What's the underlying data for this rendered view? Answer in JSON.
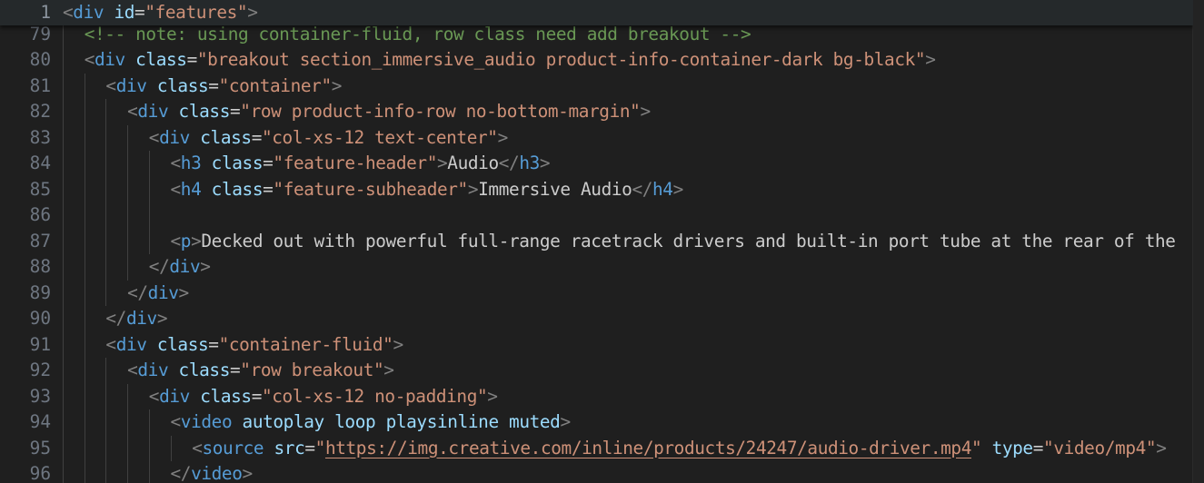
{
  "editor": {
    "sticky_line": {
      "number": "1",
      "tokens": [
        [
          "punct",
          "<"
        ],
        [
          "tag",
          "div"
        ],
        [
          "text",
          " "
        ],
        [
          "attr",
          "id"
        ],
        [
          "eq",
          "="
        ],
        [
          "str",
          "\"features\""
        ],
        [
          "punct",
          ">"
        ]
      ]
    },
    "lines": [
      {
        "number": "79",
        "indent": 1,
        "tokens": [
          [
            "comment",
            "<!-- note: using container-fluid, row class need add breakout -->"
          ]
        ]
      },
      {
        "number": "80",
        "indent": 1,
        "tokens": [
          [
            "punct",
            "<"
          ],
          [
            "tag",
            "div"
          ],
          [
            "text",
            " "
          ],
          [
            "attr",
            "class"
          ],
          [
            "eq",
            "="
          ],
          [
            "str",
            "\"breakout section_immersive_audio product-info-container-dark bg-black\""
          ],
          [
            "punct",
            ">"
          ]
        ]
      },
      {
        "number": "81",
        "indent": 2,
        "tokens": [
          [
            "punct",
            "<"
          ],
          [
            "tag",
            "div"
          ],
          [
            "text",
            " "
          ],
          [
            "attr",
            "class"
          ],
          [
            "eq",
            "="
          ],
          [
            "str",
            "\"container\""
          ],
          [
            "punct",
            ">"
          ]
        ]
      },
      {
        "number": "82",
        "indent": 3,
        "tokens": [
          [
            "punct",
            "<"
          ],
          [
            "tag",
            "div"
          ],
          [
            "text",
            " "
          ],
          [
            "attr",
            "class"
          ],
          [
            "eq",
            "="
          ],
          [
            "str",
            "\"row product-info-row no-bottom-margin\""
          ],
          [
            "punct",
            ">"
          ]
        ]
      },
      {
        "number": "83",
        "indent": 4,
        "tokens": [
          [
            "punct",
            "<"
          ],
          [
            "tag",
            "div"
          ],
          [
            "text",
            " "
          ],
          [
            "attr",
            "class"
          ],
          [
            "eq",
            "="
          ],
          [
            "str",
            "\"col-xs-12 text-center\""
          ],
          [
            "punct",
            ">"
          ]
        ]
      },
      {
        "number": "84",
        "indent": 5,
        "tokens": [
          [
            "punct",
            "<"
          ],
          [
            "tag",
            "h3"
          ],
          [
            "text",
            " "
          ],
          [
            "attr",
            "class"
          ],
          [
            "eq",
            "="
          ],
          [
            "str",
            "\"feature-header\""
          ],
          [
            "punct",
            ">"
          ],
          [
            "text",
            "Audio"
          ],
          [
            "punct",
            "</"
          ],
          [
            "tag",
            "h3"
          ],
          [
            "punct",
            ">"
          ]
        ]
      },
      {
        "number": "85",
        "indent": 5,
        "tokens": [
          [
            "punct",
            "<"
          ],
          [
            "tag",
            "h4"
          ],
          [
            "text",
            " "
          ],
          [
            "attr",
            "class"
          ],
          [
            "eq",
            "="
          ],
          [
            "str",
            "\"feature-subheader\""
          ],
          [
            "punct",
            ">"
          ],
          [
            "text",
            "Immersive Audio"
          ],
          [
            "punct",
            "</"
          ],
          [
            "tag",
            "h4"
          ],
          [
            "punct",
            ">"
          ]
        ]
      },
      {
        "number": "86",
        "indent": 5,
        "tokens": []
      },
      {
        "number": "87",
        "indent": 5,
        "tokens": [
          [
            "punct",
            "<"
          ],
          [
            "tag",
            "p"
          ],
          [
            "punct",
            ">"
          ],
          [
            "text",
            "Decked out with powerful full-range racetrack drivers and built-in port tube at the rear of the"
          ]
        ]
      },
      {
        "number": "88",
        "indent": 4,
        "tokens": [
          [
            "punct",
            "</"
          ],
          [
            "tag",
            "div"
          ],
          [
            "punct",
            ">"
          ]
        ]
      },
      {
        "number": "89",
        "indent": 3,
        "tokens": [
          [
            "punct",
            "</"
          ],
          [
            "tag",
            "div"
          ],
          [
            "punct",
            ">"
          ]
        ]
      },
      {
        "number": "90",
        "indent": 2,
        "tokens": [
          [
            "punct",
            "</"
          ],
          [
            "tag",
            "div"
          ],
          [
            "punct",
            ">"
          ]
        ]
      },
      {
        "number": "91",
        "indent": 2,
        "tokens": [
          [
            "punct",
            "<"
          ],
          [
            "tag",
            "div"
          ],
          [
            "text",
            " "
          ],
          [
            "attr",
            "class"
          ],
          [
            "eq",
            "="
          ],
          [
            "str",
            "\"container-fluid\""
          ],
          [
            "punct",
            ">"
          ]
        ]
      },
      {
        "number": "92",
        "indent": 3,
        "tokens": [
          [
            "punct",
            "<"
          ],
          [
            "tag",
            "div"
          ],
          [
            "text",
            " "
          ],
          [
            "attr",
            "class"
          ],
          [
            "eq",
            "="
          ],
          [
            "str",
            "\"row breakout\""
          ],
          [
            "punct",
            ">"
          ]
        ]
      },
      {
        "number": "93",
        "indent": 4,
        "tokens": [
          [
            "punct",
            "<"
          ],
          [
            "tag",
            "div"
          ],
          [
            "text",
            " "
          ],
          [
            "attr",
            "class"
          ],
          [
            "eq",
            "="
          ],
          [
            "str",
            "\"col-xs-12 no-padding\""
          ],
          [
            "punct",
            ">"
          ]
        ]
      },
      {
        "number": "94",
        "indent": 5,
        "tokens": [
          [
            "punct",
            "<"
          ],
          [
            "tag",
            "video"
          ],
          [
            "text",
            " "
          ],
          [
            "attr",
            "autoplay"
          ],
          [
            "text",
            " "
          ],
          [
            "attr",
            "loop"
          ],
          [
            "text",
            " "
          ],
          [
            "attr",
            "playsinline"
          ],
          [
            "text",
            " "
          ],
          [
            "attr",
            "muted"
          ],
          [
            "punct",
            ">"
          ]
        ]
      },
      {
        "number": "95",
        "indent": 6,
        "tokens": [
          [
            "punct",
            "<"
          ],
          [
            "tag",
            "source"
          ],
          [
            "text",
            " "
          ],
          [
            "attr",
            "src"
          ],
          [
            "eq",
            "="
          ],
          [
            "str",
            "\""
          ],
          [
            "link",
            "https://img.creative.com/inline/products/24247/audio-driver.mp4"
          ],
          [
            "str",
            "\""
          ],
          [
            "text",
            " "
          ],
          [
            "attr",
            "type"
          ],
          [
            "eq",
            "="
          ],
          [
            "str",
            "\"video/mp4\""
          ],
          [
            "punct",
            ">"
          ]
        ]
      },
      {
        "number": "96",
        "indent": 5,
        "tokens": [
          [
            "punct",
            "</"
          ],
          [
            "tag",
            "video"
          ],
          [
            "punct",
            ">"
          ]
        ]
      }
    ]
  }
}
